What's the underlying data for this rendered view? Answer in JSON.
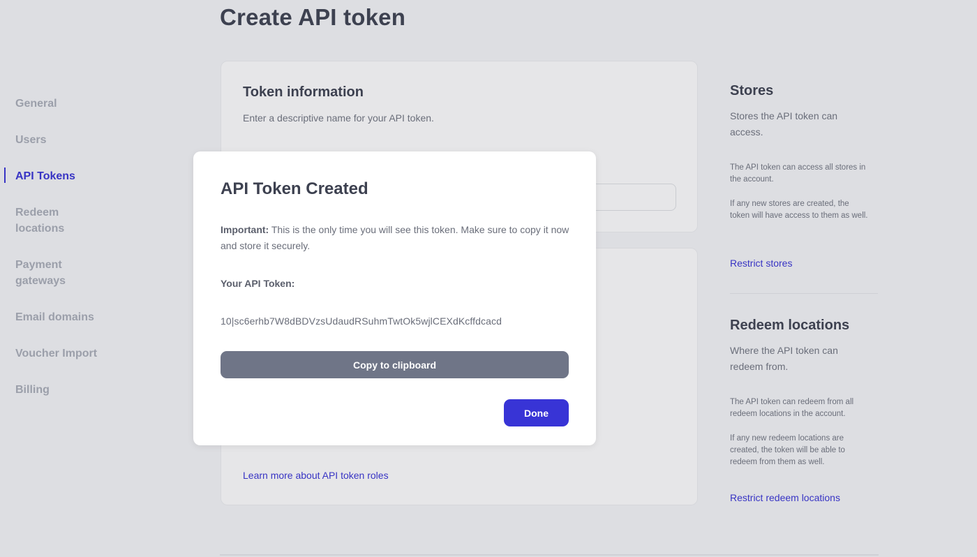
{
  "page": {
    "title": "Create API token"
  },
  "sidebar": {
    "items": [
      {
        "label": "General"
      },
      {
        "label": "Users"
      },
      {
        "label": "API Tokens",
        "active": true
      },
      {
        "label": "Redeem\nlocations"
      },
      {
        "label": "Payment\ngateways"
      },
      {
        "label": "Email domains"
      },
      {
        "label": "Voucher Import"
      },
      {
        "label": "Billing"
      }
    ]
  },
  "token_info": {
    "title": "Token information",
    "description": "Enter a descriptive name for your API token."
  },
  "roles": {
    "learn_more_link": "Learn more about API token roles"
  },
  "stores": {
    "title": "Stores",
    "subtitle": "Stores the API token can access.",
    "note_1": "The API token can access all stores in the account.",
    "note_2": "If any new stores are created, the token will have access to them as well.",
    "link": "Restrict stores"
  },
  "redeem_locations": {
    "title": "Redeem locations",
    "subtitle": "Where the API token can redeem from.",
    "note_1": "The API token can redeem from all redeem locations in the account.",
    "note_2": "If any new redeem locations are created, the token will be able to redeem from them as well.",
    "link": "Restrict redeem locations"
  },
  "modal": {
    "title": "API Token Created",
    "warning_label": "Important:",
    "warning_text": " This is the only time you will see this token. Make sure to copy it now and store it securely.",
    "token_label": "Your API Token:",
    "token_value": "10|sc6erhb7W8dBDVzsUdaudRSuhmTwtOk5wjlCEXdKcffdcacd",
    "copy_button": "Copy to clipboard",
    "done_button": "Done"
  },
  "colors": {
    "accent": "#3834d6",
    "copy_button_bg": "#6f7587",
    "background": "#dddee2"
  }
}
